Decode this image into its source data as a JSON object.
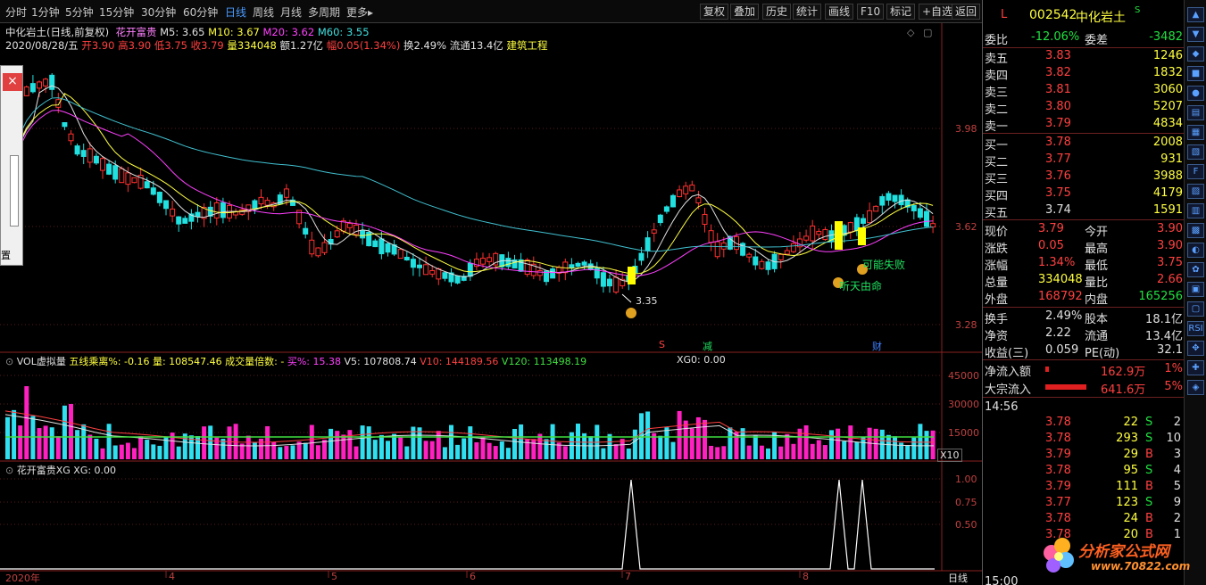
{
  "toolbar": {
    "periods": [
      "分时",
      "1分钟",
      "5分钟",
      "15分钟",
      "30分钟",
      "60分钟",
      "日线",
      "周线",
      "月线",
      "多周期",
      "更多▸"
    ],
    "active_period": "日线",
    "buttons": [
      "复权",
      "叠加",
      "历史",
      "统计",
      "画线",
      "F10",
      "标记",
      "+自选",
      "返回"
    ]
  },
  "header": {
    "stock_line": "中化岩土(日线,前复权)",
    "indicator_name": "花开富贵",
    "m5": "M5: 3.65",
    "m10": "M10: 3.67",
    "m20": "M20: 3.62",
    "m60": "M60: 3.55",
    "date": "2020/08/28/五",
    "open": "开3.90",
    "high": "高3.90",
    "low": "低3.75",
    "close": "收3.79",
    "volume": "量334048",
    "amount": "额1.27亿",
    "change": "幅0.05(1.34%)",
    "turnover": "换2.49%",
    "float": "流通13.4亿",
    "industry": "建筑工程"
  },
  "price_axis": [
    "3.98",
    "3.62",
    "3.28"
  ],
  "annotations": {
    "low_mark": "3.35",
    "fail_text": "可能失败",
    "fate_text": "听天由命",
    "marker_s": "S",
    "marker_jian": "减",
    "marker_cai": "财"
  },
  "volume_pane": {
    "title": "VOL虚拟量",
    "ratio": "五线乘离%: -0.16",
    "qty": "量: 108547.46",
    "multiple": "成交量倍数: -",
    "buy_pct": "买%: 15.38",
    "v5": "V5: 107808.74",
    "v10": "V10: 144189.56",
    "v120": "V120: 113498.19",
    "xg0": "XG0: 0.00",
    "axis": [
      "45000",
      "30000",
      "15000"
    ],
    "unit": "X10"
  },
  "signal_pane": {
    "title": "花开富贵XG",
    "xg": "XG: 0.00",
    "axis": [
      "1.00",
      "0.75",
      "0.50"
    ]
  },
  "x_axis": [
    "2020年",
    "4",
    "5",
    "6",
    "7",
    "8"
  ],
  "period_label": "日线",
  "left_panel": {
    "label": "置"
  },
  "quote": {
    "market": "L",
    "code": "002542",
    "name": "中化岩土",
    "flag": "S",
    "webi_label": "委比",
    "webi": "-12.06%",
    "weicha_label": "委差",
    "weicha": "-3482",
    "asks": [
      {
        "label": "卖五",
        "price": "3.83",
        "vol": "1246"
      },
      {
        "label": "卖四",
        "price": "3.82",
        "vol": "1832"
      },
      {
        "label": "卖三",
        "price": "3.81",
        "vol": "3060"
      },
      {
        "label": "卖二",
        "price": "3.80",
        "vol": "5207"
      },
      {
        "label": "卖一",
        "price": "3.79",
        "vol": "4834"
      }
    ],
    "bids": [
      {
        "label": "买一",
        "price": "3.78",
        "vol": "2008"
      },
      {
        "label": "买二",
        "price": "3.77",
        "vol": "931"
      },
      {
        "label": "买三",
        "price": "3.76",
        "vol": "3988"
      },
      {
        "label": "买四",
        "price": "3.75",
        "vol": "4179"
      },
      {
        "label": "买五",
        "price": "3.74",
        "vol": "1591"
      }
    ],
    "stats": [
      {
        "l1": "现价",
        "v1": "3.79",
        "l2": "今开",
        "v2": "3.90",
        "c1": "#ff4040",
        "c2": "#ff4040"
      },
      {
        "l1": "涨跌",
        "v1": "0.05",
        "l2": "最高",
        "v2": "3.90",
        "c1": "#ff4040",
        "c2": "#ff4040"
      },
      {
        "l1": "涨幅",
        "v1": "1.34%",
        "l2": "最低",
        "v2": "3.75",
        "c1": "#ff4040",
        "c2": "#ff4040"
      },
      {
        "l1": "总量",
        "v1": "334048",
        "l2": "量比",
        "v2": "2.66",
        "c1": "#ffff40",
        "c2": "#ff4040"
      },
      {
        "l1": "外盘",
        "v1": "168792",
        "l2": "内盘",
        "v2": "165256",
        "c1": "#ff4040",
        "c2": "#20e040"
      }
    ],
    "fund": [
      {
        "l1": "换手",
        "v1": "2.49%",
        "l2": "股本",
        "v2": "18.1亿"
      },
      {
        "l1": "净资",
        "v1": "2.22",
        "l2": "流通",
        "v2": "13.4亿"
      },
      {
        "l1": "收益(三)",
        "v1": "0.059",
        "l2": "PE(动)",
        "v2": "32.1"
      }
    ],
    "flows": [
      {
        "label": "净流入额",
        "value": "162.9万",
        "pct": "1%",
        "bar": 0.08
      },
      {
        "label": "大宗流入",
        "value": "641.6万",
        "pct": "5%",
        "bar": 0.92
      }
    ],
    "time": "14:56",
    "ticks": [
      {
        "price": "3.78",
        "vol": "22",
        "side": "S",
        "n": "2"
      },
      {
        "price": "3.78",
        "vol": "293",
        "side": "S",
        "n": "10"
      },
      {
        "price": "3.79",
        "vol": "29",
        "side": "B",
        "n": "3"
      },
      {
        "price": "3.78",
        "vol": "95",
        "side": "S",
        "n": "4"
      },
      {
        "price": "3.79",
        "vol": "111",
        "side": "B",
        "n": "5"
      },
      {
        "price": "3.77",
        "vol": "123",
        "side": "S",
        "n": "9"
      },
      {
        "price": "3.78",
        "vol": "24",
        "side": "B",
        "n": "2"
      },
      {
        "price": "3.78",
        "vol": "20",
        "side": "B",
        "n": "1"
      }
    ],
    "bottom_time": "15:00"
  },
  "iconbar": [
    "▲",
    "▼",
    "◆",
    "■",
    "●",
    "▤",
    "▦",
    "▧",
    "F",
    "▨",
    "▥",
    "▩",
    "◐",
    "✿",
    "▣",
    "▢",
    "RSI",
    "✥",
    "✚",
    "◈"
  ],
  "watermark": {
    "text": "分析家公式网",
    "url": "www.70822.com"
  }
}
